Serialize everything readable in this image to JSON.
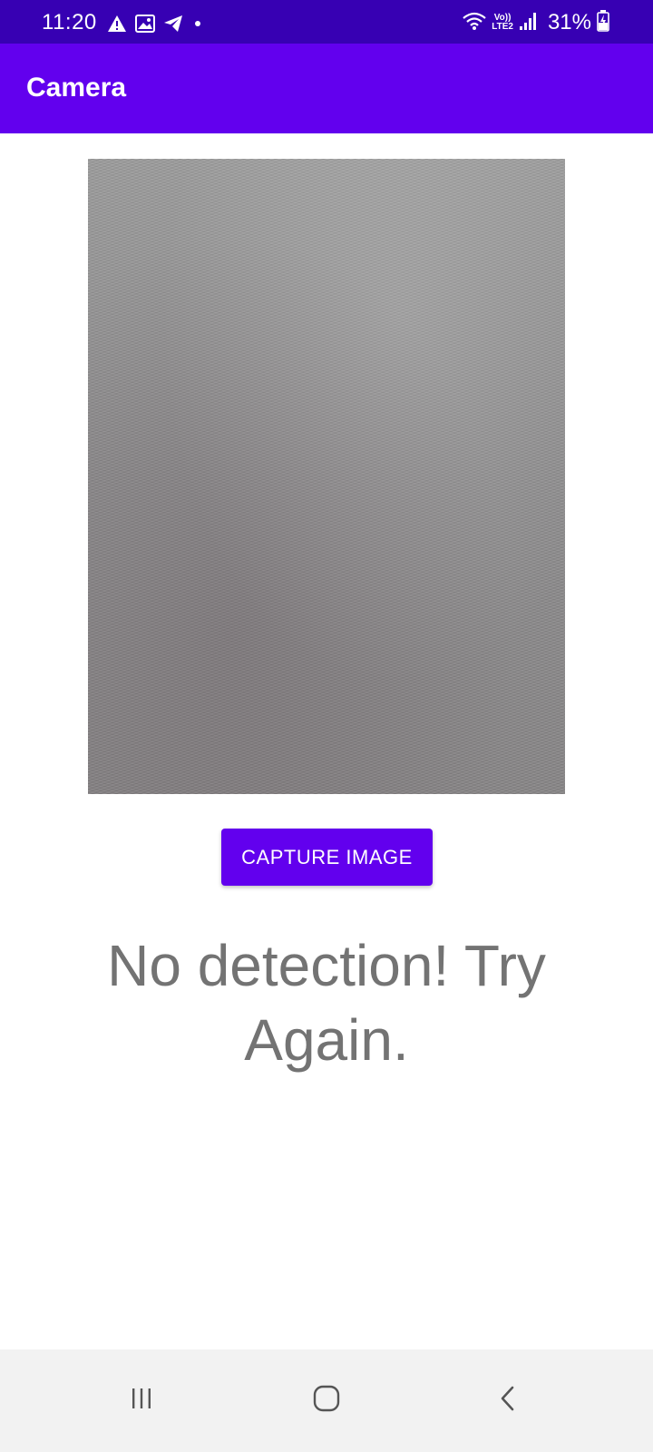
{
  "status_bar": {
    "time": "11:20",
    "left_icons": [
      "warning-icon",
      "image-icon",
      "telegram-icon",
      "dot-icon"
    ],
    "network": {
      "line1": "Vo))",
      "line2": "LTE2"
    },
    "right_icons": [
      "wifi-icon",
      "signal-icon",
      "battery-charging-icon"
    ],
    "battery": "31%"
  },
  "app_bar": {
    "title": "Camera"
  },
  "main": {
    "capture_button_label": "CAPTURE IMAGE",
    "result_text": "No detection! Try Again."
  },
  "nav_bar": {
    "buttons": [
      "recent-apps-icon",
      "home-icon",
      "back-icon"
    ]
  },
  "colors": {
    "status_bar": "#3700b3",
    "primary": "#6200ee",
    "result_text": "#737373",
    "nav_bar": "#f2f2f2"
  }
}
